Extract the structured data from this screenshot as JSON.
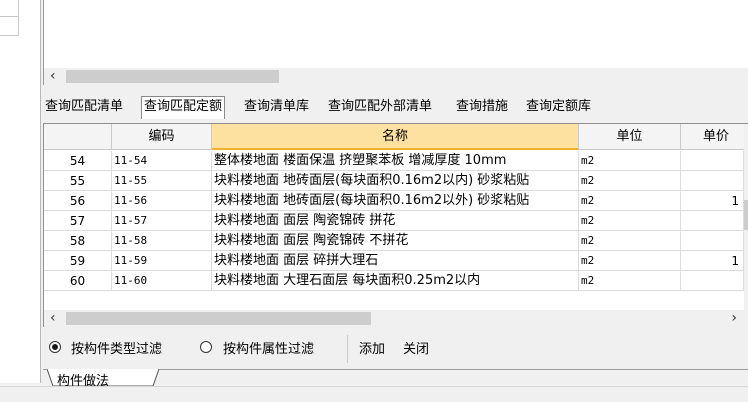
{
  "tabs": [
    {
      "label": "查询匹配清单",
      "active": false
    },
    {
      "label": "查询匹配定额",
      "active": true
    },
    {
      "label": "查询清单库",
      "active": false
    },
    {
      "label": "查询匹配外部清单",
      "active": false
    },
    {
      "label": "查询措施",
      "active": false
    },
    {
      "label": "查询定额库",
      "active": false
    }
  ],
  "grid": {
    "columns": [
      "",
      "编码",
      "名称",
      "单位",
      "单价"
    ],
    "rows": [
      {
        "idx": "54",
        "code": "11-54",
        "name": "整体楼地面 楼面保温 挤塑聚苯板 增减厚度 10mm",
        "unit": "m2",
        "price": ""
      },
      {
        "idx": "55",
        "code": "11-55",
        "name": "块料楼地面 地砖面层(每块面积0.16m2以内) 砂浆粘贴",
        "unit": "m2",
        "price": ""
      },
      {
        "idx": "56",
        "code": "11-56",
        "name": "块料楼地面 地砖面层(每块面积0.16m2以外) 砂浆粘贴",
        "unit": "m2",
        "price": "1"
      },
      {
        "idx": "57",
        "code": "11-57",
        "name": "块料楼地面 面层 陶瓷锦砖 拼花",
        "unit": "m2",
        "price": ""
      },
      {
        "idx": "58",
        "code": "11-58",
        "name": "块料楼地面 面层 陶瓷锦砖 不拼花",
        "unit": "m2",
        "price": ""
      },
      {
        "idx": "59",
        "code": "11-59",
        "name": "块料楼地面 面层 碎拼大理石",
        "unit": "m2",
        "price": "1"
      },
      {
        "idx": "60",
        "code": "11-60",
        "name": "块料楼地面 大理石面层 每块面积0.25m2以内",
        "unit": "m2",
        "price": ""
      }
    ]
  },
  "filter": {
    "option_type": "按构件类型过滤",
    "option_attr": "按构件属性过滤",
    "add_label": "添加",
    "close_label": "关闭"
  },
  "bottom_tab": {
    "label": "构件做法"
  },
  "icons": {
    "scroll_left": "chevron-left-icon",
    "scroll_right": "chevron-right-icon",
    "scroll_up": "chevron-up-icon"
  },
  "colors": {
    "header_highlight": "#fde1a0",
    "header_highlight_border": "#f0b030"
  }
}
